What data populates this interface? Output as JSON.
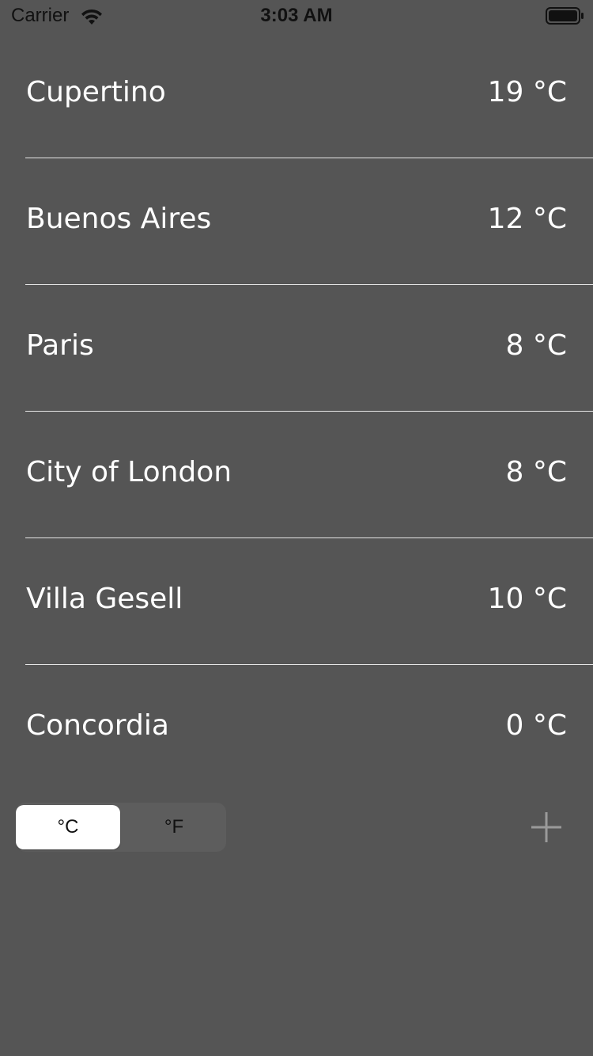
{
  "status_bar": {
    "carrier": "Carrier",
    "time": "3:03 AM"
  },
  "cities": [
    {
      "name": "Cupertino",
      "temp": "19 °C"
    },
    {
      "name": "Buenos Aires",
      "temp": "12 °C"
    },
    {
      "name": "Paris",
      "temp": "8 °C"
    },
    {
      "name": "City of London",
      "temp": "8 °C"
    },
    {
      "name": "Villa Gesell",
      "temp": "10 °C"
    },
    {
      "name": "Concordia",
      "temp": "0 °C"
    }
  ],
  "units": {
    "options": [
      "°C",
      "°F"
    ],
    "selected": "°C"
  },
  "icons": {
    "add": "plus-icon",
    "wifi": "wifi-icon",
    "battery": "battery-icon"
  },
  "colors": {
    "background": "#555555",
    "text": "#ffffff",
    "separator": "#e6e6e6",
    "add_icon": "#9a9a9a"
  }
}
